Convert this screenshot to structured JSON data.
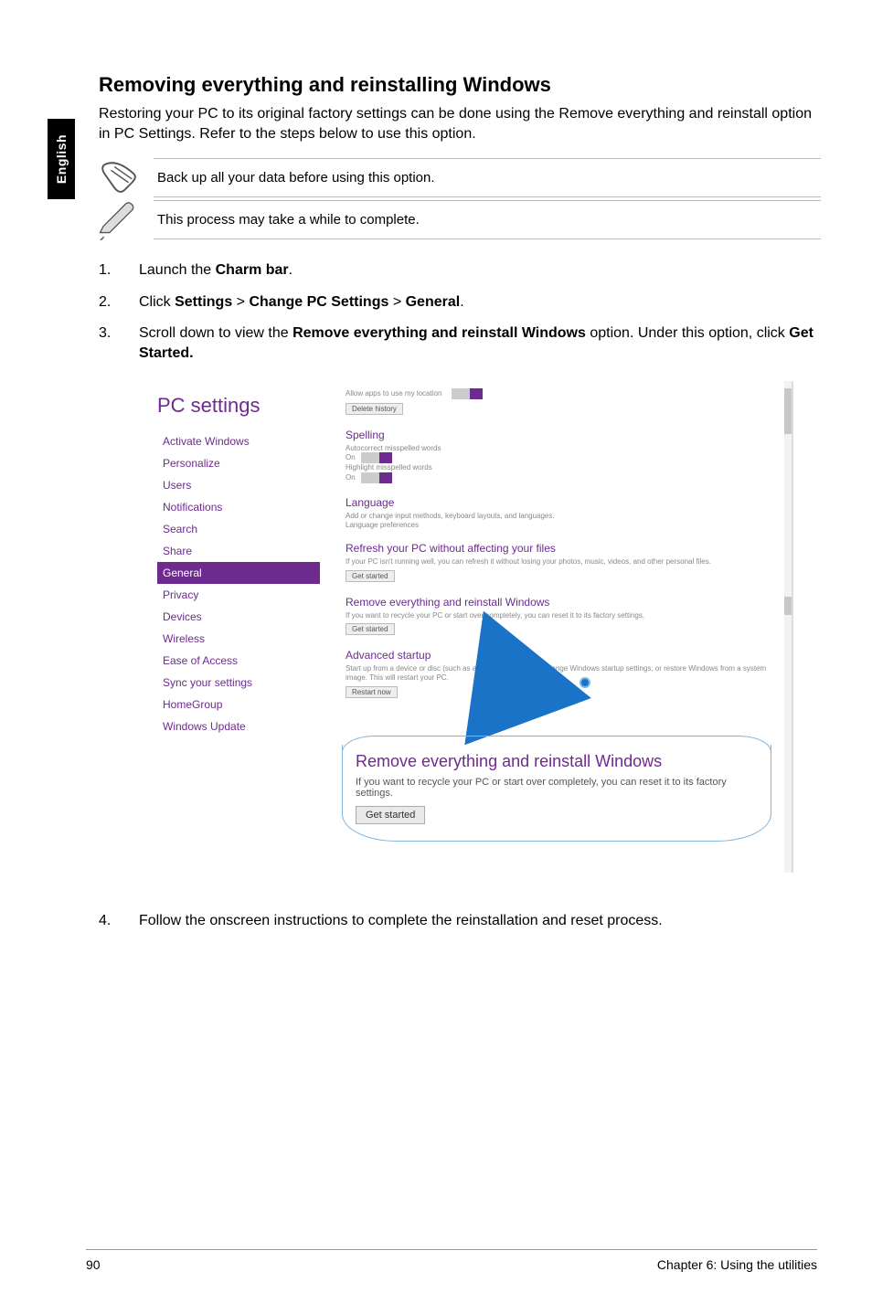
{
  "sideTab": "English",
  "title": "Removing everything and reinstalling Windows",
  "intro": "Restoring your PC to its original factory settings can be done using the Remove everything and reinstall option in PC Settings. Refer to the steps below to use this option.",
  "note1": "Back up all your data before using this option.",
  "note2": "This process may take a while to complete.",
  "step1_a": "Launch the ",
  "step1_b": "Charm bar",
  "step1_c": ".",
  "step2_a": "Click ",
  "step2_b": "Settings",
  "step2_c": " > ",
  "step2_d": "Change PC Settings",
  "step2_e": " > ",
  "step2_f": "General",
  "step2_g": ".",
  "step3_a": "Scroll down to view the ",
  "step3_b": "Remove everything and reinstall Windows",
  "step3_c": " option. Under this option, click ",
  "step3_d": "Get Started.",
  "step4": "Follow the onscreen instructions to complete the reinstallation and reset process.",
  "shot": {
    "brand": "PC settings",
    "nav": {
      "0": "Activate Windows",
      "1": "Personalize",
      "2": "Users",
      "3": "Notifications",
      "4": "Search",
      "5": "Share",
      "6": "General",
      "7": "Privacy",
      "8": "Devices",
      "9": "Wireless",
      "10": "Ease of Access",
      "11": "Sync your settings",
      "12": "HomeGroup",
      "13": "Windows Update"
    },
    "right": {
      "spelling": "Spelling",
      "spelling_sub1": "Autocorrect misspelled words",
      "spelling_on1": "On",
      "spelling_sub2": "Highlight misspelled words",
      "spelling_on2": "On",
      "language": "Language",
      "language_sub": "Add or change input methods, keyboard layouts, and languages.",
      "language_link": "Language preferences",
      "refresh": "Refresh your PC without affecting your files",
      "refresh_sub": "If your PC isn't running well, you can refresh it without losing your photos, music, videos, and other personal files.",
      "refresh_btn": "Get started",
      "remove": "Remove everything and reinstall Windows",
      "remove_sub": "If you want to recycle your PC or start over completely, you can reset it to its factory settings.",
      "remove_btn": "Get started",
      "advanced": "Advanced startup",
      "advanced_sub": "Start up from a device or disc (such as a USB drive or DVD), change Windows startup settings, or restore Windows from a system image. This will restart your PC.",
      "advanced_btn": "Restart now"
    },
    "callout": {
      "title": "Remove everything and reinstall Windows",
      "body": "If you want to recycle your PC or start over completely, you can reset it to its factory settings.",
      "btn": "Get started"
    }
  },
  "footer": {
    "page": "90",
    "chapter": "Chapter 6: Using the utilities"
  }
}
